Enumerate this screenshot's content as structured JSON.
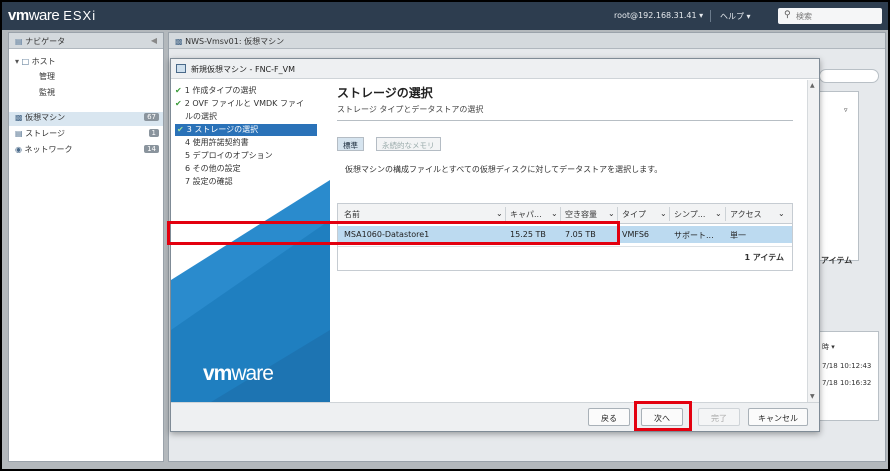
{
  "app": {
    "logo_vm": "vm",
    "logo_ware": "ware",
    "logo_product": "ESXi",
    "user": "root@192.168.31.41 ▾",
    "help": "ヘルプ ▾",
    "search_placeholder": "検索"
  },
  "navigator": {
    "title": "ナビゲータ",
    "items": [
      {
        "label": "ホスト",
        "count": ""
      },
      {
        "label": "管理",
        "count": ""
      },
      {
        "label": "監視",
        "count": ""
      },
      {
        "label": "仮想マシン",
        "count": "67"
      },
      {
        "label": "ストレージ",
        "count": "1"
      },
      {
        "label": "ネットワーク",
        "count": "14"
      }
    ]
  },
  "content": {
    "title": "NWS-Vmsv01: 仮想マシン",
    "bg_col": "アイテム",
    "bg_time": "時 ▾",
    "bg_ts1": "7/18 10:12:43",
    "bg_ts2": "7/18 10:16:32"
  },
  "dialog": {
    "title": "新規仮想マシン - FNC-F_VM",
    "steps": [
      {
        "label": "1 作成タイプの選択",
        "done": true
      },
      {
        "label": "2 OVF ファイルと VMDK ファイ",
        "done": true
      },
      {
        "label": "ルの選択",
        "done": false
      },
      {
        "label": "3 ストレージの選択",
        "done": true
      },
      {
        "label": "4 使用許諾契約書",
        "done": false
      },
      {
        "label": "5 デプロイのオプション",
        "done": false
      },
      {
        "label": "6 その他の設定",
        "done": false
      },
      {
        "label": "7 設定の確認",
        "done": false
      }
    ],
    "logo": {
      "vm": "vm",
      "ware": "ware"
    },
    "heading": "ストレージの選択",
    "subheading": "ストレージ タイプとデータストアの選択",
    "tabs": {
      "standard": "標準",
      "persistent": "永続的なメモリ"
    },
    "description": "仮想マシンの構成ファイルとすべての仮想ディスクに対してデータストアを選択します。",
    "table": {
      "columns": [
        "名前",
        "キャパ...",
        "空き容量",
        "タイプ",
        "シンプ...",
        "アクセス"
      ],
      "rows": [
        [
          "MSA1060-Datastore1",
          "15.25 TB",
          "7.05 TB",
          "VMFS6",
          "サポート...",
          "単一"
        ]
      ],
      "footer": "1 アイテム"
    },
    "buttons": {
      "back": "戻る",
      "next": "次へ",
      "finish": "完了",
      "cancel": "キャンセル"
    }
  },
  "colors": {
    "topbar": "#2d3d4f",
    "step_panel": "#1f7fc0",
    "selected_row": "#bcdaf0",
    "highlight": "#e3000f"
  }
}
